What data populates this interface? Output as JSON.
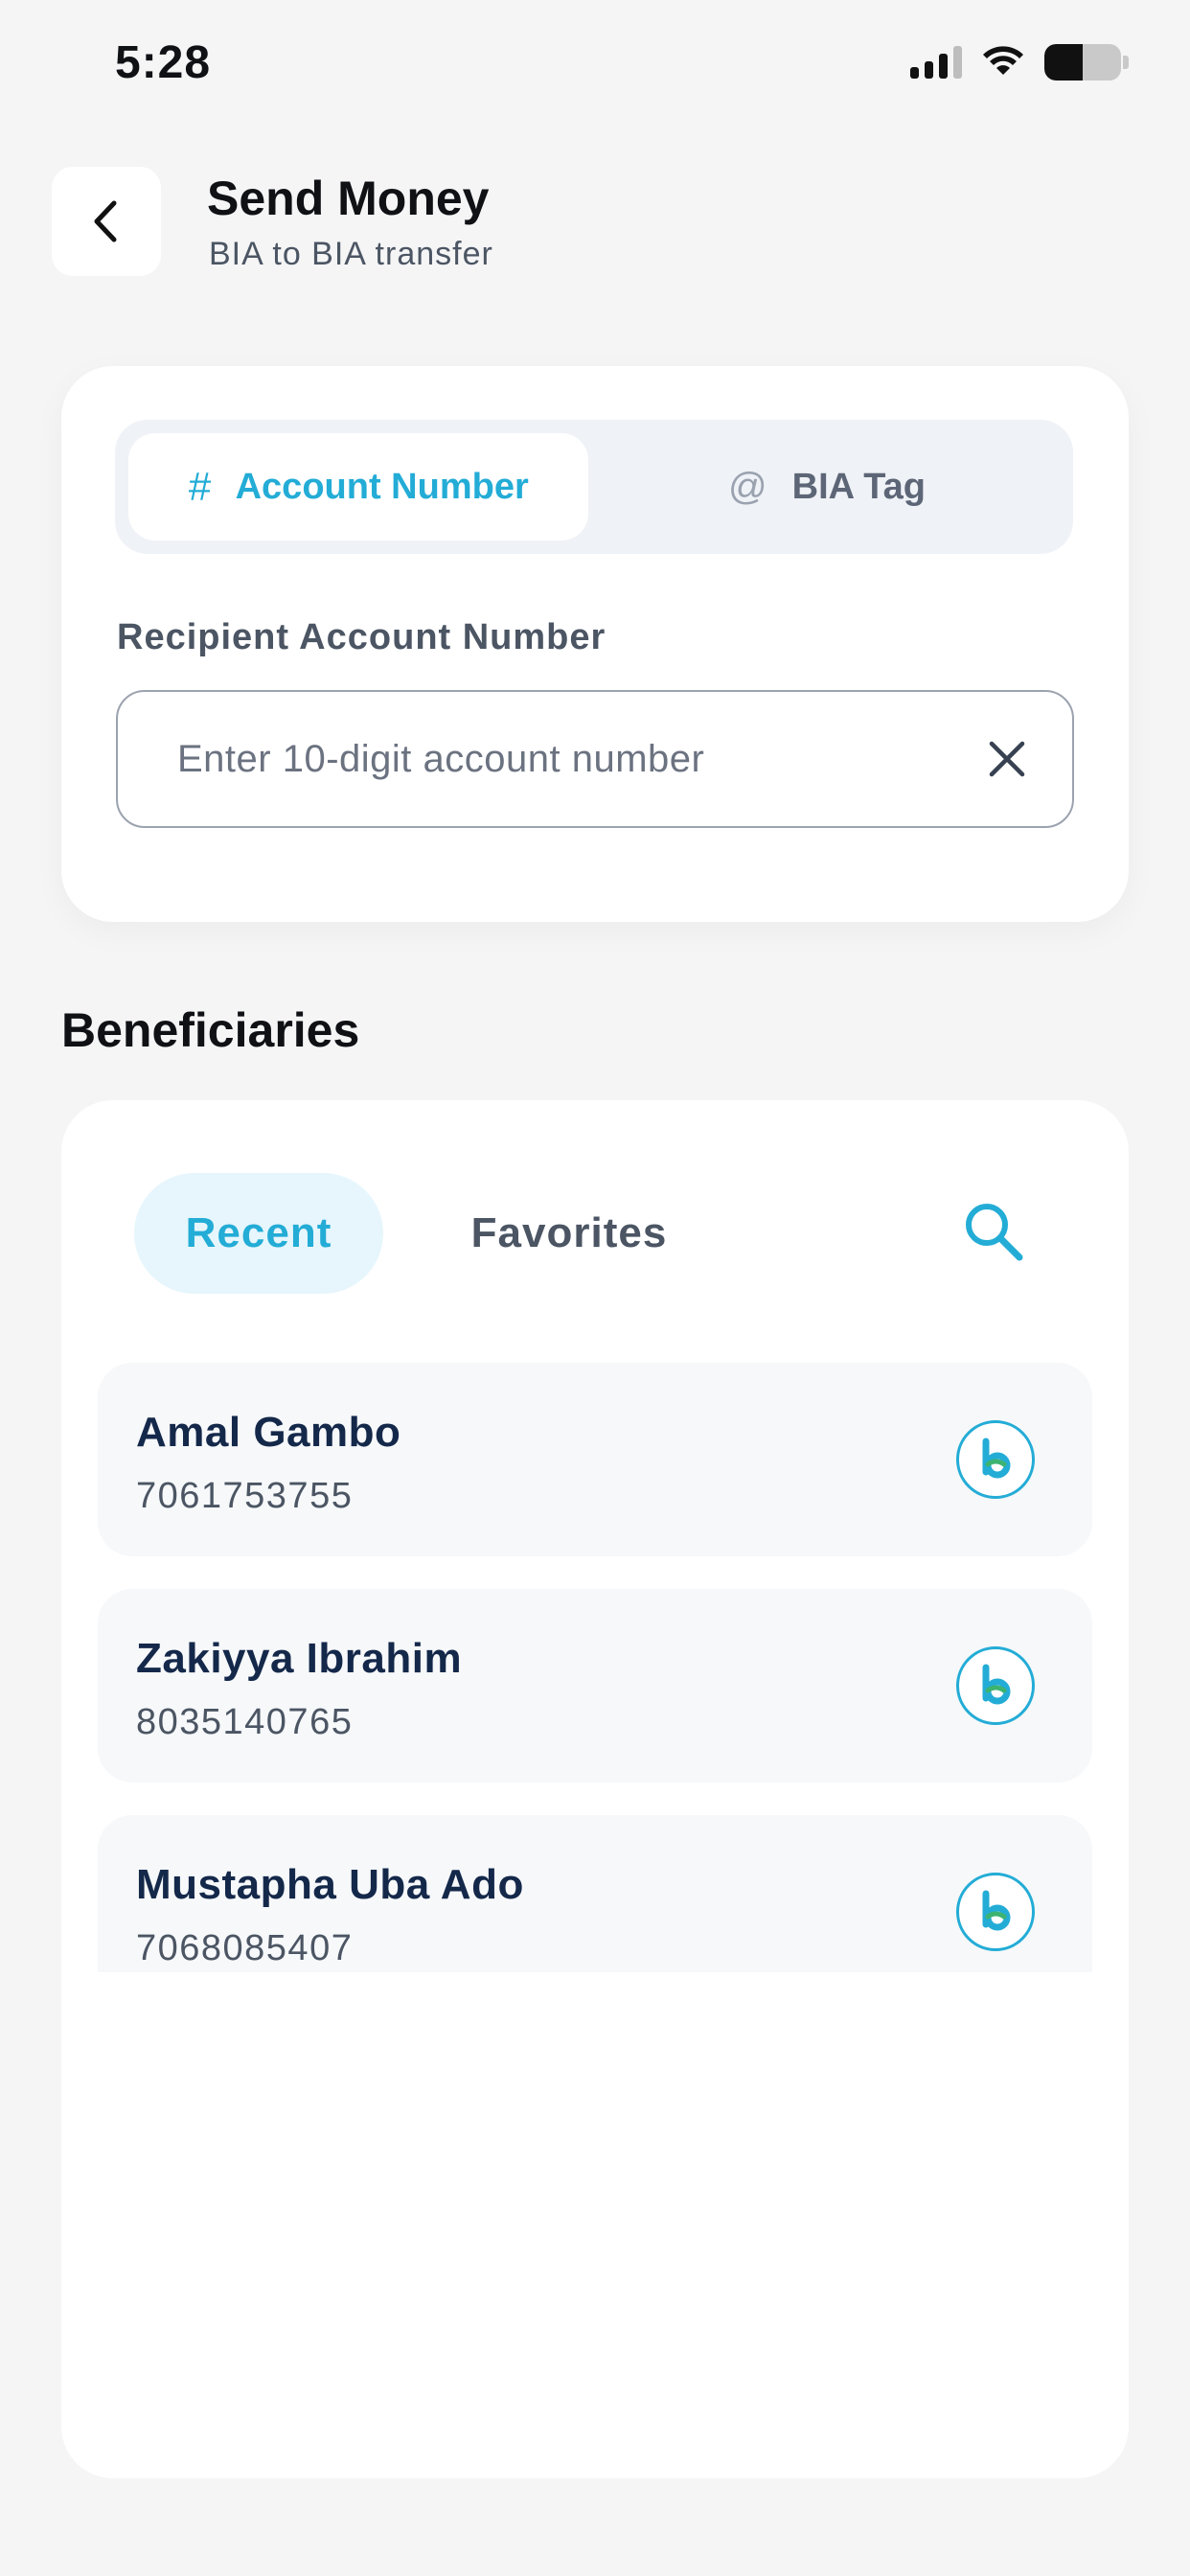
{
  "status_bar": {
    "time": "5:28",
    "icons": [
      "signal-icon",
      "wifi-icon",
      "battery-icon"
    ],
    "battery_level": 0.5
  },
  "header": {
    "title": "Send Money",
    "subtitle": "BIA to BIA transfer",
    "back_icon": "chevron-left-icon"
  },
  "transfer_type": {
    "options": [
      {
        "label": "Account Number",
        "icon": "#",
        "selected": true
      },
      {
        "label": "BIA Tag",
        "icon": "@",
        "selected": false
      }
    ]
  },
  "recipient": {
    "label": "Recipient Account Number",
    "placeholder": "Enter 10-digit account number",
    "value": "",
    "clear_icon": "close-icon"
  },
  "beneficiaries": {
    "title": "Beneficiaries",
    "tabs": [
      {
        "label": "Recent",
        "selected": true
      },
      {
        "label": "Favorites",
        "selected": false
      }
    ],
    "search_icon": "search-icon",
    "items": [
      {
        "name": "Amal Gambo",
        "account": "7061753755",
        "logo": "bia-logo-icon"
      },
      {
        "name": "Zakiyya Ibrahim",
        "account": "8035140765",
        "logo": "bia-logo-icon"
      },
      {
        "name": "Mustapha Uba Ado",
        "account": "7068085407",
        "logo": "bia-logo-icon"
      }
    ]
  },
  "colors": {
    "accent": "#23acd6",
    "background": "#f5f5f6",
    "card": "#ffffff",
    "name_text": "#14284a"
  }
}
